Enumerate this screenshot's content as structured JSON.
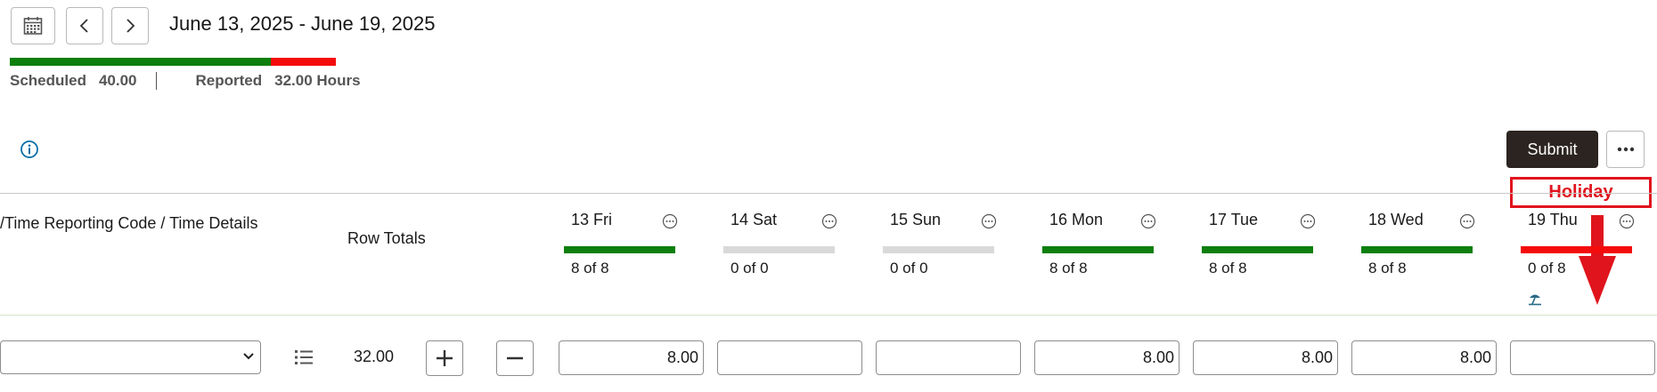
{
  "toolbar": {
    "icons": {
      "calendar": "calendar-icon",
      "prev": "chevron-left-icon",
      "next": "chevron-right-icon"
    },
    "date_range": "June 13, 2025 - June 19, 2025"
  },
  "summary": {
    "scheduled_label": "Scheduled",
    "scheduled_value": "40.00",
    "reported_label": "Reported",
    "reported_value": "32.00 Hours",
    "reported_fraction": 0.8
  },
  "actions": {
    "info_icon": "info-icon",
    "submit_label": "Submit",
    "more_icon": "more-horizontal-icon"
  },
  "annotation": {
    "label": "Holiday",
    "arrow_icon": "down-arrow-icon"
  },
  "grid": {
    "column_header": "/Time Reporting Code / Time Details",
    "row_totals_label": "Row Totals",
    "days": [
      {
        "label": "13 Fri",
        "hours": "8 of 8",
        "status": "complete"
      },
      {
        "label": "14 Sat",
        "hours": "0 of 0",
        "status": "none"
      },
      {
        "label": "15 Sun",
        "hours": "0 of 0",
        "status": "none"
      },
      {
        "label": "16 Mon",
        "hours": "8 of 8",
        "status": "complete"
      },
      {
        "label": "17 Tue",
        "hours": "8 of 8",
        "status": "complete"
      },
      {
        "label": "18 Wed",
        "hours": "8 of 8",
        "status": "complete"
      },
      {
        "label": "19 Thu",
        "hours": "0 of 8",
        "status": "missing"
      }
    ],
    "day_icon": "more-circle-icon",
    "holiday_icon": "beach-umbrella-icon"
  },
  "row": {
    "time_reporting_code": "",
    "details_icon": "list-details-icon",
    "total": "32.00",
    "add_icon": "plus-icon",
    "remove_icon": "minus-icon",
    "entries": [
      "8.00",
      "",
      "",
      "8.00",
      "8.00",
      "8.00",
      ""
    ]
  },
  "colors": {
    "complete": "#0d7f0d",
    "missing": "#f40c0c",
    "none": "#d9d9d9",
    "annotation": "#e0141d",
    "submit_bg": "#2b2420",
    "info": "#0b6ea8"
  }
}
